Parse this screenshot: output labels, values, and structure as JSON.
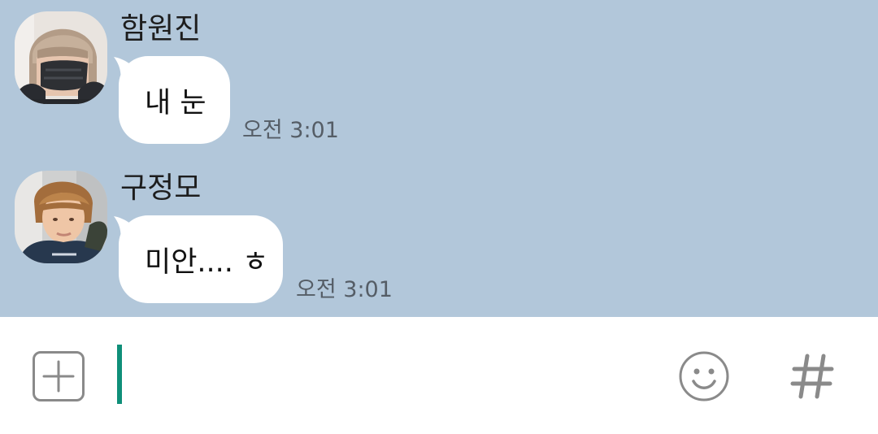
{
  "messages": [
    {
      "sender": "함원진",
      "text": "내 눈",
      "time": "오전 3:01",
      "avatar": "avatar-masked-light-hair"
    },
    {
      "sender": "구정모",
      "text": "미안.... ㅎ",
      "time": "오전 3:01",
      "avatar": "avatar-brown-hair"
    }
  ],
  "input": {
    "value": "",
    "add_icon": "plus-square-icon",
    "emoji_icon": "smiley-icon",
    "hash_icon": "hash-icon"
  },
  "colors": {
    "chat_background": "#b2c7da",
    "bubble": "#ffffff",
    "cursor": "#0f8f79",
    "icon_gray": "#8a8a8a"
  }
}
